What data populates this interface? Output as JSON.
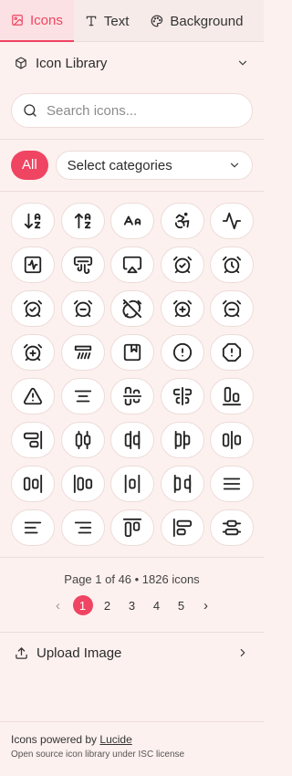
{
  "tabs": [
    {
      "label": "Icons",
      "icon": "image-icon",
      "active": true
    },
    {
      "label": "Text",
      "icon": "type-icon",
      "active": false
    },
    {
      "label": "Background",
      "icon": "palette-icon",
      "active": false
    }
  ],
  "library": {
    "label": "Icon Library",
    "icon": "box-icon"
  },
  "search": {
    "placeholder": "Search icons..."
  },
  "filters": {
    "all_label": "All",
    "categories_label": "Select categories"
  },
  "icons": [
    "arrow-down-a-z",
    "arrow-up-a-z",
    "a-large-small",
    "accessibility",
    "activity",
    "activity-square",
    "air-vent",
    "airplay",
    "alarm-check",
    "alarm-clock",
    "alarm-clock-check",
    "alarm-clock-minus",
    "alarm-clock-off",
    "alarm-clock-plus",
    "alarm-minus",
    "alarm-plus",
    "album-vent",
    "album",
    "alert-circle",
    "alert-octagon",
    "alert-triangle",
    "align-center",
    "align-center-horizontal",
    "align-center-vertical",
    "align-end-horizontal",
    "align-end-vertical",
    "align-horizontal-distribute-center",
    "align-horizontal-distribute-end",
    "align-horizontal-distribute-start",
    "align-horizontal-justify-center",
    "align-horizontal-justify-end",
    "align-horizontal-justify-start",
    "align-horizontal-space-around",
    "align-horizontal-space-between",
    "align-justify",
    "align-left",
    "align-right",
    "align-start-horizontal",
    "align-start-vertical",
    "align-vertical-distribute-center"
  ],
  "pagination": {
    "info": "Page 1 of 46 • 1826 icons",
    "pages": [
      "1",
      "2",
      "3",
      "4",
      "5"
    ],
    "prev": "‹",
    "next": "›"
  },
  "upload": {
    "label": "Upload Image"
  },
  "footer": {
    "powered_prefix": "Icons powered by ",
    "powered_link": "Lucide",
    "license": "Open source icon library under ISC license"
  },
  "colors": {
    "accent": "#ef4462",
    "background": "#fdf1ef"
  }
}
